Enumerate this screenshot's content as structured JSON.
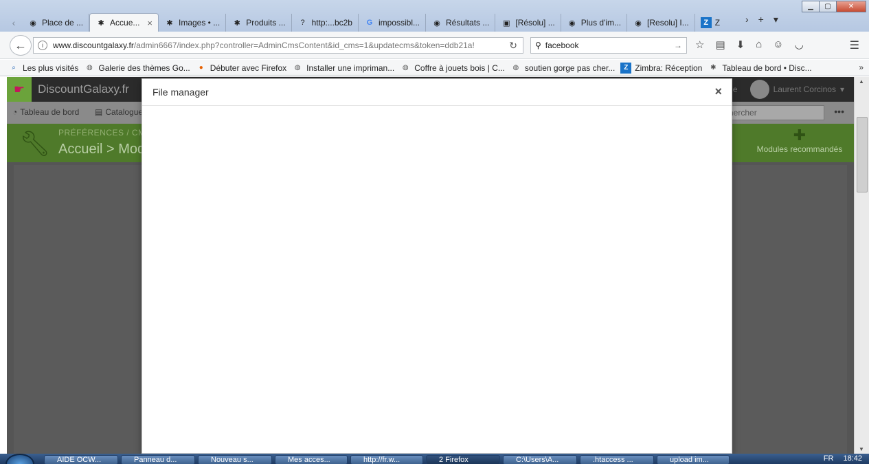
{
  "browser": {
    "tabs": [
      {
        "label": "Place de ...",
        "icon": "ie-icon"
      },
      {
        "label": "Accue...",
        "icon": "bee-icon",
        "active": true
      },
      {
        "label": "Images • ...",
        "icon": "bee-icon"
      },
      {
        "label": "Produits ...",
        "icon": "bee-icon"
      },
      {
        "label": "http:...bc2b",
        "icon": "question-icon"
      },
      {
        "label": "impossibl...",
        "icon": "google-icon"
      },
      {
        "label": "Résultats ...",
        "icon": "ie-icon"
      },
      {
        "label": "[Résolu] ...",
        "icon": "forum-icon"
      },
      {
        "label": "Plus d'im...",
        "icon": "ie-icon"
      },
      {
        "label": "[Resolu] I...",
        "icon": "ie-icon"
      },
      {
        "label": "Z",
        "icon": "zimbra-icon"
      }
    ],
    "tab_close": "×",
    "url": {
      "domain": "www.discountgalaxy.fr",
      "path": "/admin6667/index.php?controller=AdminCmsContent&id_cms=1&updatecms&token=ddb21a!"
    },
    "search": {
      "value": "facebook"
    },
    "bookmarks": [
      {
        "label": "Les plus visités"
      },
      {
        "label": "Galerie des thèmes Go..."
      },
      {
        "label": "Débuter avec Firefox"
      },
      {
        "label": "Installer une impriman..."
      },
      {
        "label": "Coffre à jouets bois | C..."
      },
      {
        "label": "soutien gorge pas cher..."
      },
      {
        "label": "Zimbra: Réception"
      },
      {
        "label": "Tableau de bord • Disc..."
      }
    ],
    "bookmarks_more": "»"
  },
  "admin": {
    "shop_name": "DiscountGalaxy.fr",
    "user_name": "Laurent Corcinos",
    "header_fragment": "e",
    "menu": [
      {
        "label": "Tableau de bord"
      },
      {
        "label": "Catalogue"
      }
    ],
    "search_placeholder": "chercher",
    "breadcrumb": "PRÉFÉRENCES  /  CM",
    "heading": "Accueil > Mod",
    "modules_label": "Modules recommandés"
  },
  "modal": {
    "title": "File manager",
    "close": "×"
  },
  "taskbar": {
    "items": [
      {
        "label": "AIDE OCW..."
      },
      {
        "label": "Panneau d..."
      },
      {
        "label": "Nouveau s..."
      },
      {
        "label": "Mes acces..."
      },
      {
        "label": "http://fr.w..."
      },
      {
        "label": "2 Firefox",
        "active": true
      },
      {
        "label": "C:\\Users\\A..."
      },
      {
        "label": ".htaccess ..."
      },
      {
        "label": "upload im..."
      }
    ],
    "lang": "FR",
    "clock": "18:42"
  }
}
